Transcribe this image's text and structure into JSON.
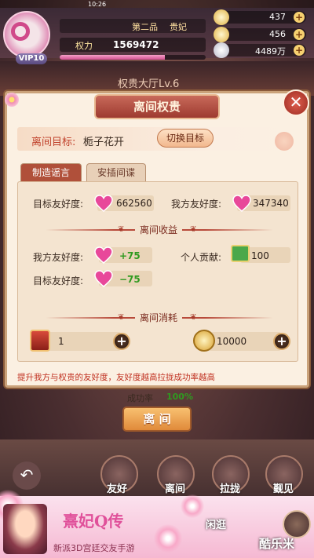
{
  "status_bar": {
    "time": "10:26"
  },
  "player": {
    "vip": "VIP10",
    "power_label": "权力",
    "power": "1569472",
    "rank_a": "第二品",
    "rank_b": "贵妃",
    "exp_fraction": 0.72
  },
  "resources": [
    {
      "icon": "ingot-icon",
      "value": "437"
    },
    {
      "icon": "gold-ingot-icon",
      "value": "456"
    },
    {
      "icon": "silver-icon",
      "value": "4489万"
    }
  ],
  "background": {
    "hall_title": "权贵大厅Lv.6"
  },
  "dialog": {
    "title": "离间权贵",
    "target_label": "离间目标:",
    "target_name": "栀子花开",
    "switch_label": "切换目标",
    "tabs": [
      "制造谣言",
      "安插间谍"
    ],
    "active_tab": 0,
    "target_favor_label": "目标友好度:",
    "target_favor_value": "662560",
    "our_favor_label": "我方友好度:",
    "our_favor_value": "347340",
    "income_title": "离间收益",
    "income_our_label": "我方友好度:",
    "income_our_value": "+75",
    "income_contrib_label": "个人贡献:",
    "income_contrib_value": "100",
    "income_target_label": "目标友好度:",
    "income_target_value": "−75",
    "cost_title": "离间消耗",
    "cost_item_value": "1",
    "cost_silver_value": "10000",
    "hint": "提升我方与权贵的友好度，友好度越高拉拢成功率越高",
    "rate_label": "成功率",
    "rate_value": "100%",
    "action_label": "离 间"
  },
  "bottom_menu": [
    "友好",
    "离间",
    "拉拢",
    "觐见"
  ],
  "ad": {
    "logo": "熹妃Q传",
    "tagline": "新派3D宫廷交友手游",
    "watermark": "酷乐米",
    "bottom_word": "闲逛"
  },
  "colors": {
    "accent_red": "#b0503a",
    "heart_pink": "#e8489a",
    "green_positive": "#2f9a20",
    "hint_red": "#c03020"
  }
}
